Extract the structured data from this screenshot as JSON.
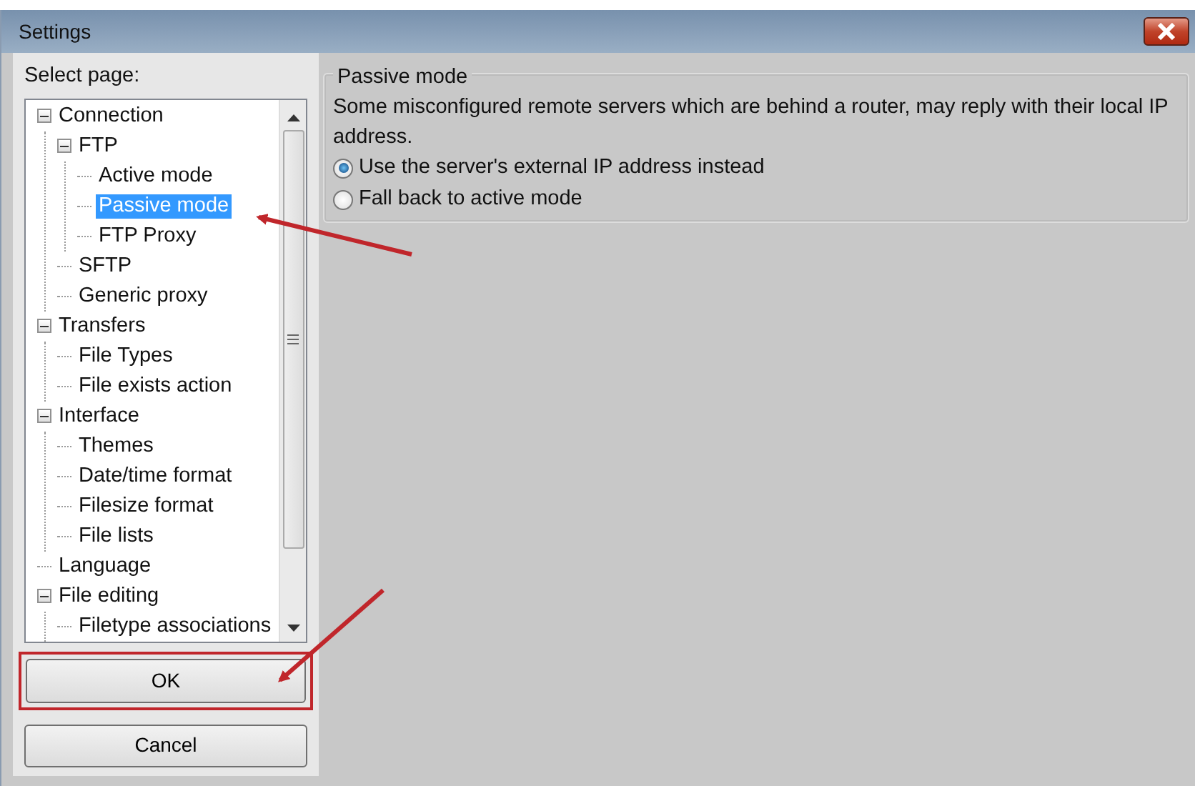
{
  "window": {
    "title": "Settings"
  },
  "sidebar": {
    "label": "Select page:",
    "tree": [
      {
        "label": "Connection",
        "expanded": true,
        "selected": false,
        "children": [
          {
            "label": "FTP",
            "expanded": true,
            "selected": false,
            "children": [
              {
                "label": "Active mode",
                "selected": false
              },
              {
                "label": "Passive mode",
                "selected": true
              },
              {
                "label": "FTP Proxy",
                "selected": false
              }
            ]
          },
          {
            "label": "SFTP",
            "selected": false
          },
          {
            "label": "Generic proxy",
            "selected": false
          }
        ]
      },
      {
        "label": "Transfers",
        "expanded": true,
        "selected": false,
        "children": [
          {
            "label": "File Types",
            "selected": false
          },
          {
            "label": "File exists action",
            "selected": false
          }
        ]
      },
      {
        "label": "Interface",
        "expanded": true,
        "selected": false,
        "children": [
          {
            "label": "Themes",
            "selected": false
          },
          {
            "label": "Date/time format",
            "selected": false
          },
          {
            "label": "Filesize format",
            "selected": false
          },
          {
            "label": "File lists",
            "selected": false
          }
        ]
      },
      {
        "label": "Language",
        "selected": false
      },
      {
        "label": "File editing",
        "expanded": true,
        "selected": false,
        "children": [
          {
            "label": "Filetype associations",
            "selected": false
          }
        ]
      }
    ]
  },
  "buttons": [
    "OK",
    "Cancel"
  ],
  "group": {
    "title": "Passive mode",
    "description": "Some misconfigured remote servers which are behind a router, may reply with their local IP address.",
    "options": [
      {
        "label": "Use the server's external IP address instead",
        "checked": true
      },
      {
        "label": "Fall back to active mode",
        "checked": false
      }
    ]
  }
}
